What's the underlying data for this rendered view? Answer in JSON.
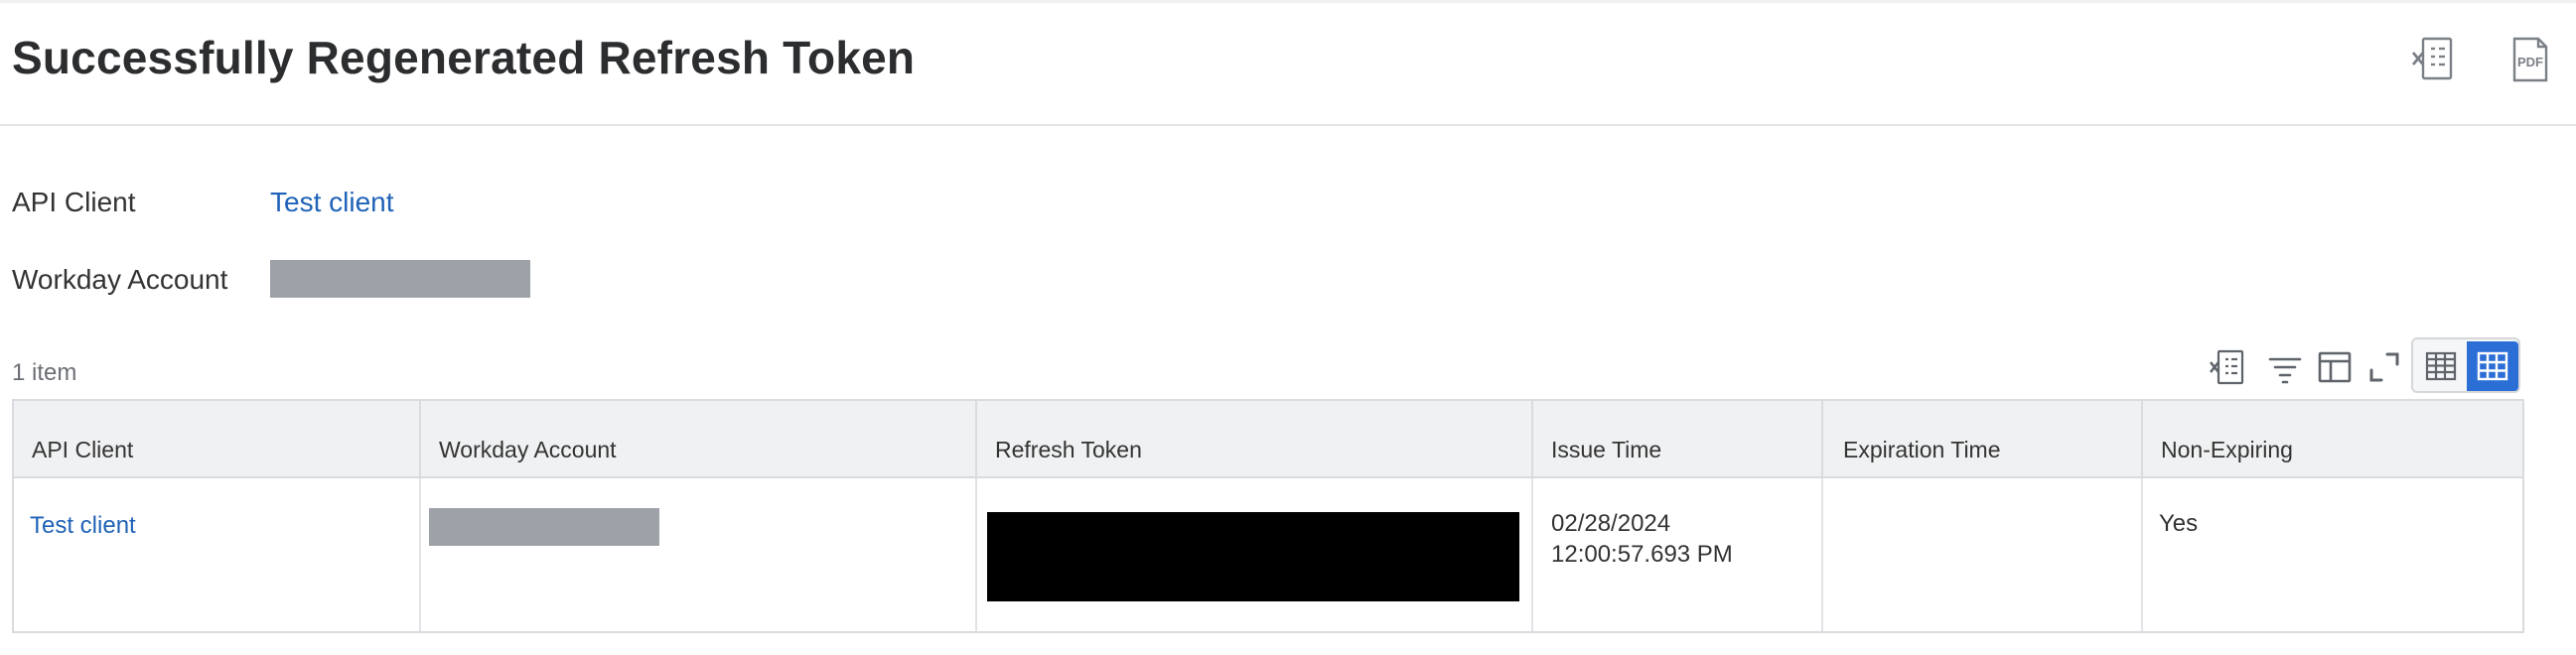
{
  "page": {
    "title": "Successfully Regenerated Refresh Token"
  },
  "header_actions": {
    "excel_icon": "export-to-excel-icon",
    "pdf_icon": "export-to-pdf-icon",
    "pdf_label": "PDF"
  },
  "fields": {
    "api_client_label": "API Client",
    "api_client_value": "Test client",
    "workday_account_label": "Workday Account"
  },
  "table": {
    "item_count": "1 item",
    "columns": [
      "API Client",
      "Workday Account",
      "Refresh Token",
      "Issue Time",
      "Expiration Time",
      "Non-Expiring"
    ],
    "rows": [
      {
        "api_client": "Test client",
        "issue_date": "02/28/2024",
        "issue_clock": "12:00:57.693 PM",
        "expiration_time": "",
        "non_expiring": "Yes"
      }
    ]
  },
  "toolbar": {
    "icons": [
      "export-to-excel-icon",
      "filter-icon",
      "column-layout-icon",
      "fullscreen-icon",
      "table-view-icon",
      "grid-view-icon"
    ]
  },
  "colors": {
    "link": "#1f62b7",
    "active_toggle": "#2b6fd6",
    "redaction_gray": "#9ea2a8"
  }
}
